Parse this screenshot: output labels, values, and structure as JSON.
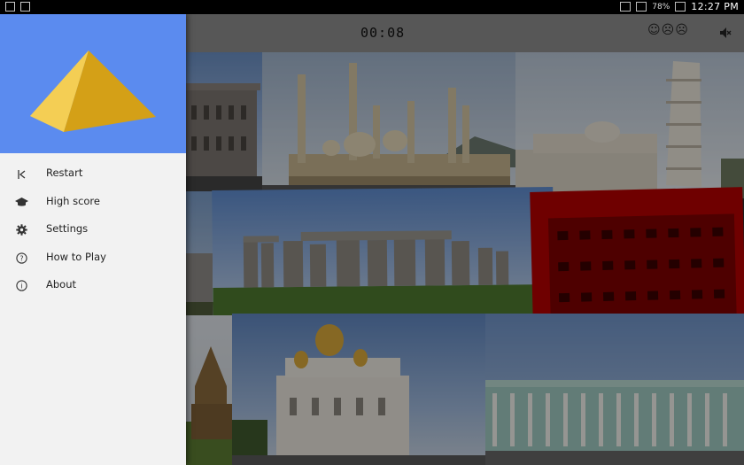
{
  "status_bar": {
    "battery": "78%",
    "time": "12:27 PM"
  },
  "game": {
    "timer": "00:08",
    "faces": "☺☹☹"
  },
  "drawer": {
    "items": [
      {
        "label": "Restart",
        "icon": "restart-icon"
      },
      {
        "label": "High score",
        "icon": "graduation-cap-icon"
      },
      {
        "label": "Settings",
        "icon": "gear-icon"
      },
      {
        "label": "How to Play",
        "icon": "help-icon"
      },
      {
        "label": "About",
        "icon": "info-icon"
      }
    ]
  },
  "colors": {
    "drawer_header": "#5b8bef",
    "pyramid_light": "#f2c94c",
    "pyramid_dark": "#d4a017",
    "red_tile": "#b30000"
  }
}
